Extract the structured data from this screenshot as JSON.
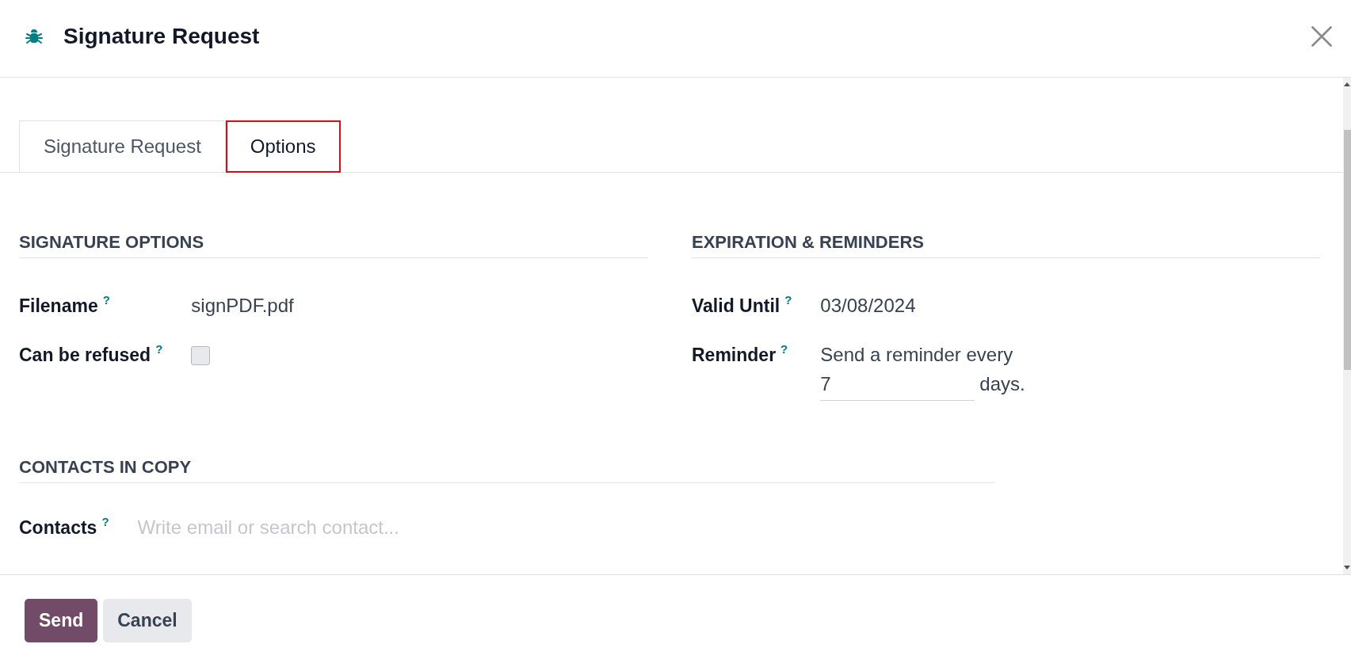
{
  "dialog": {
    "title": "Signature Request"
  },
  "tabs": [
    {
      "label": "Signature Request",
      "selected": false,
      "highlighted": false
    },
    {
      "label": "Options",
      "selected": true,
      "highlighted": true
    }
  ],
  "option_groups": [
    {
      "title": "SIGNATURE OPTIONS",
      "fields": [
        {
          "kind": "text",
          "label": "Filename",
          "help": "?",
          "value": "signPDF.pdf"
        },
        {
          "kind": "checkbox",
          "label": "Can be refused",
          "help": "?",
          "checked": false
        }
      ]
    },
    {
      "title": "EXPIRATION & REMINDERS",
      "fields": [
        {
          "kind": "text",
          "label": "Valid Until",
          "help": "?",
          "value": "03/08/2024"
        },
        {
          "kind": "reminder",
          "label": "Reminder",
          "help": "?",
          "text": "Send a reminder every",
          "value": "7",
          "unit": "days."
        }
      ]
    }
  ],
  "contacts_group": {
    "title": "CONTACTS IN COPY",
    "fields": [
      {
        "kind": "tags",
        "label": "Contacts",
        "help": "?",
        "placeholder": "Write email or search contact..."
      }
    ]
  },
  "buttons": [
    {
      "label": "Send",
      "kind": "primary"
    },
    {
      "label": "Cancel",
      "kind": "secondary"
    }
  ]
}
